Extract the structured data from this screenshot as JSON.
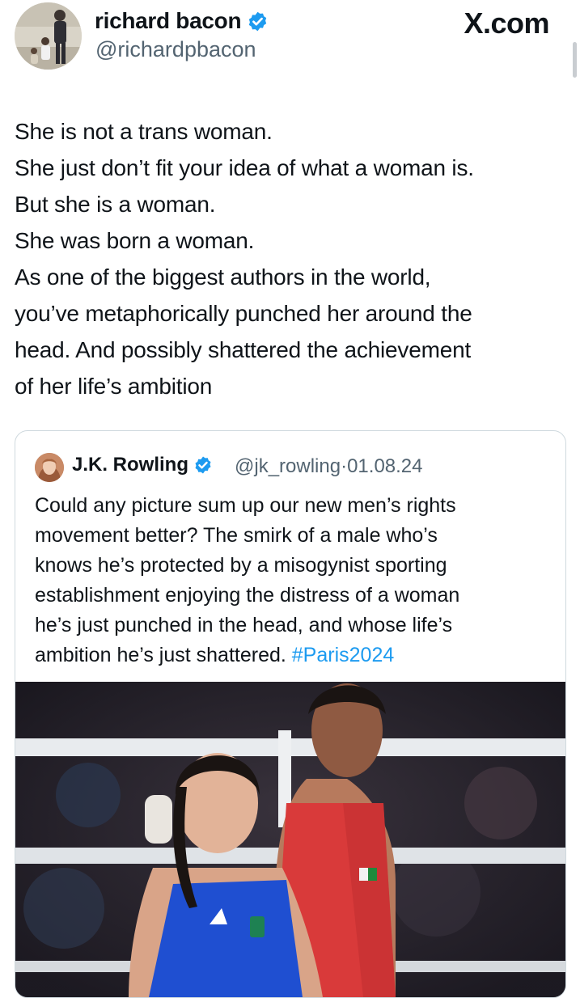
{
  "source_label": "X.com",
  "author": {
    "name": "richard bacon",
    "handle": "@richardpbacon"
  },
  "tweet": {
    "lines": [
      "She is not a trans woman.",
      "She just don’t fit your idea of what a woman is.",
      "But she is a woman.",
      "She was born a woman.",
      "As one of the biggest authors in the world,",
      "you’ve metaphorically punched her around the",
      "head. And possibly shattered the achievement",
      "of her life’s ambition"
    ]
  },
  "quoted_tweet": {
    "name": "J.K. Rowling",
    "handle": "@jk_rowling",
    "separator": "·",
    "date": "01.08.24",
    "lines": [
      "Could any picture sum up our new men’s rights",
      "movement better? The smirk of a male who’s",
      "knows he’s protected by a misogynist sporting",
      "establishment enjoying the distress of a woman",
      "he’s just punched in the head, and whose life’s",
      "ambition he’s just shattered."
    ],
    "hashtag": "#Paris2024"
  },
  "colors": {
    "text": "#0f1419",
    "secondary": "#536471",
    "link": "#1d9bf0",
    "verified": "#1d9bf0",
    "blue_kit": "#1f4fd1",
    "red_kit": "#d93a3a"
  },
  "icons": {
    "verified": "verified-badge-icon",
    "brand": "x-logo"
  }
}
